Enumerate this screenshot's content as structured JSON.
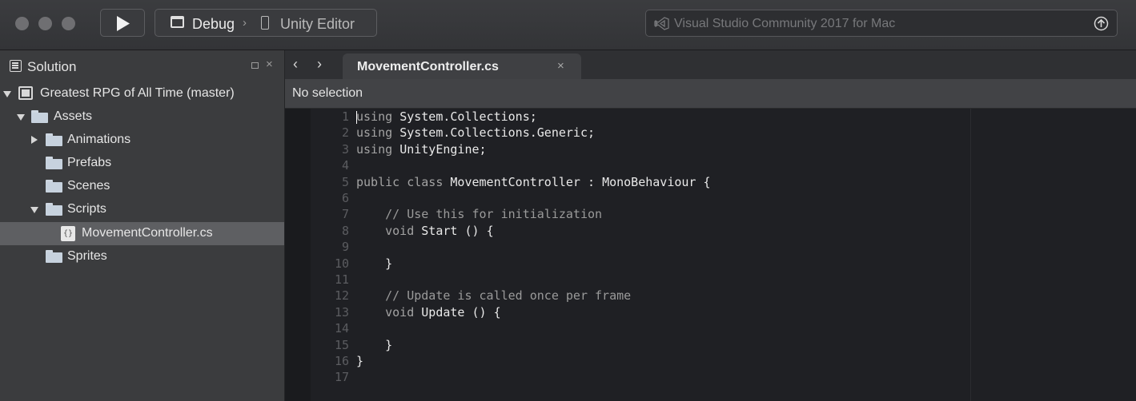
{
  "toolbar": {
    "run_icon": "play-icon",
    "config_label": "Debug",
    "separator": "›",
    "target_label": "Unity Editor",
    "status_text": "Visual Studio Community 2017 for Mac",
    "status_icon": "visual-studio-icon",
    "update_icon": "arrow-up-circle-icon"
  },
  "solution_pad": {
    "title": "Solution",
    "close_glyph": "×",
    "items": [
      {
        "label": "Greatest RPG of All Time (master)",
        "icon": "solution-icon",
        "expanded": true
      },
      {
        "label": "Assets",
        "icon": "folder-icon",
        "expanded": true
      },
      {
        "label": "Animations",
        "icon": "folder-icon",
        "expanded": false
      },
      {
        "label": "Prefabs",
        "icon": "folder-icon"
      },
      {
        "label": "Scenes",
        "icon": "folder-icon"
      },
      {
        "label": "Scripts",
        "icon": "folder-icon",
        "expanded": true
      },
      {
        "label": "MovementController.cs",
        "icon": "csharp-file-icon",
        "selected": true
      },
      {
        "label": "Sprites",
        "icon": "folder-icon"
      }
    ]
  },
  "editor": {
    "nav_back": "‹",
    "nav_forward": "›",
    "tab_label": "MovementController.cs",
    "tab_close": "×",
    "path_text": "No selection",
    "lines": [
      {
        "n": "1",
        "code": "using System.Collections;"
      },
      {
        "n": "2",
        "code": "using System.Collections.Generic;"
      },
      {
        "n": "3",
        "code": "using UnityEngine;"
      },
      {
        "n": "4",
        "code": ""
      },
      {
        "n": "5",
        "code": "public class MovementController : MonoBehaviour {"
      },
      {
        "n": "6",
        "code": ""
      },
      {
        "n": "7",
        "code": "    // Use this for initialization"
      },
      {
        "n": "8",
        "code": "    void Start () {"
      },
      {
        "n": "9",
        "code": ""
      },
      {
        "n": "10",
        "code": "    }"
      },
      {
        "n": "11",
        "code": ""
      },
      {
        "n": "12",
        "code": "    // Update is called once per frame"
      },
      {
        "n": "13",
        "code": "    void Update () {"
      },
      {
        "n": "14",
        "code": ""
      },
      {
        "n": "15",
        "code": "    }"
      },
      {
        "n": "16",
        "code": "}"
      },
      {
        "n": "17",
        "code": ""
      }
    ]
  }
}
